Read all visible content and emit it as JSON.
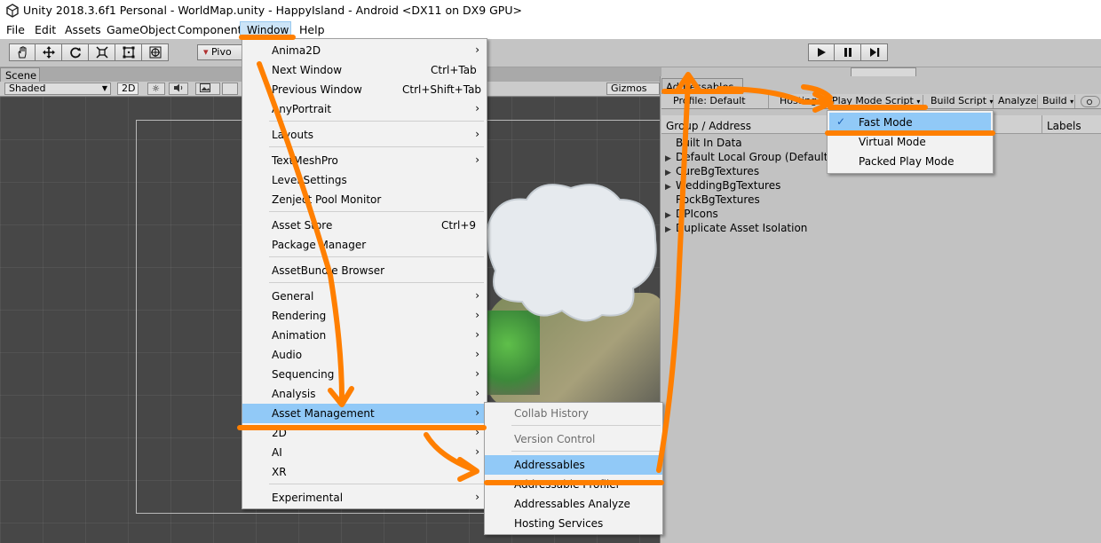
{
  "window": {
    "title": "Unity 2018.3.6f1 Personal - WorldMap.unity - HappyIsland - Android <DX11 on DX9 GPU>"
  },
  "menubar": {
    "items": [
      "File",
      "Edit",
      "Assets",
      "GameObject",
      "Component",
      "Window",
      "Help"
    ],
    "active": "Window"
  },
  "toolbar": {
    "tools": [
      "hand-icon",
      "move-icon",
      "rotate-icon",
      "scale-icon",
      "rect-icon",
      "transform-icon"
    ],
    "pivot_label": "Pivo",
    "play_controls": [
      "play-icon",
      "pause-icon",
      "step-icon"
    ]
  },
  "scene": {
    "tab": "Scene",
    "shading": "Shaded",
    "mode_2d": "2D",
    "gizmos": "Gizmos"
  },
  "addressables": {
    "tab": "Addressables",
    "toolbar": {
      "profile": "Profile: Default",
      "hosting": "Hosting",
      "play_mode_script": "Play Mode Script",
      "build_script": "Build Script",
      "analyze": "Analyze",
      "build": "Build"
    },
    "header": {
      "group_col": "Group / Address",
      "labels_col": "Labels"
    },
    "groups": [
      {
        "name": "Built In Data",
        "expandable": false
      },
      {
        "name": "Default Local Group (Default)",
        "expandable": true
      },
      {
        "name": "CureBgTextures",
        "expandable": true
      },
      {
        "name": "WeddingBgTextures",
        "expandable": true
      },
      {
        "name": "RockBgTextures",
        "expandable": false
      },
      {
        "name": "DPIcons",
        "expandable": true
      },
      {
        "name": "Duplicate Asset Isolation",
        "expandable": true
      }
    ]
  },
  "play_mode_menu": {
    "items": [
      {
        "label": "Fast Mode",
        "checked": true,
        "highlighted": true
      },
      {
        "label": "Virtual Mode",
        "checked": false,
        "highlighted": false
      },
      {
        "label": "Packed Play Mode",
        "checked": false,
        "highlighted": false
      }
    ]
  },
  "window_menu": {
    "items": [
      {
        "label": "Anima2D",
        "shortcut": "",
        "submenu": true
      },
      {
        "label": "Next Window",
        "shortcut": "Ctrl+Tab",
        "submenu": false
      },
      {
        "label": "Previous Window",
        "shortcut": "Ctrl+Shift+Tab",
        "submenu": false
      },
      {
        "label": "AnyPortrait",
        "shortcut": "",
        "submenu": true
      },
      {
        "label": "Layouts",
        "shortcut": "",
        "submenu": true
      },
      {
        "label": "TextMeshPro",
        "shortcut": "",
        "submenu": true
      },
      {
        "label": "Level Settings",
        "shortcut": "",
        "submenu": false
      },
      {
        "label": "Zenject Pool Monitor",
        "shortcut": "",
        "submenu": false
      },
      {
        "label": "Asset Store",
        "shortcut": "Ctrl+9",
        "submenu": false
      },
      {
        "label": "Package Manager",
        "shortcut": "",
        "submenu": false
      },
      {
        "label": "AssetBundle Browser",
        "shortcut": "",
        "submenu": false
      },
      {
        "label": "General",
        "shortcut": "",
        "submenu": true
      },
      {
        "label": "Rendering",
        "shortcut": "",
        "submenu": true
      },
      {
        "label": "Animation",
        "shortcut": "",
        "submenu": true
      },
      {
        "label": "Audio",
        "shortcut": "",
        "submenu": true
      },
      {
        "label": "Sequencing",
        "shortcut": "",
        "submenu": true
      },
      {
        "label": "Analysis",
        "shortcut": "",
        "submenu": true
      },
      {
        "label": "Asset Management",
        "shortcut": "",
        "submenu": true,
        "highlighted": true
      },
      {
        "label": "2D",
        "shortcut": "",
        "submenu": true
      },
      {
        "label": "AI",
        "shortcut": "",
        "submenu": true
      },
      {
        "label": "XR",
        "shortcut": "",
        "submenu": true
      },
      {
        "label": "Experimental",
        "shortcut": "",
        "submenu": true
      }
    ]
  },
  "asset_management_menu": {
    "items": [
      {
        "label": "Collab History",
        "disabled": true
      },
      {
        "label": "Version Control",
        "disabled": true
      },
      {
        "label": "Addressables",
        "highlighted": true
      },
      {
        "label": "Addressable Profiler"
      },
      {
        "label": "Addressables Analyze"
      },
      {
        "label": "Hosting Services"
      }
    ]
  },
  "colors": {
    "annotation": "#ff7f00",
    "menu_highlight": "#91c9f7",
    "scene_bg": "#474747"
  }
}
